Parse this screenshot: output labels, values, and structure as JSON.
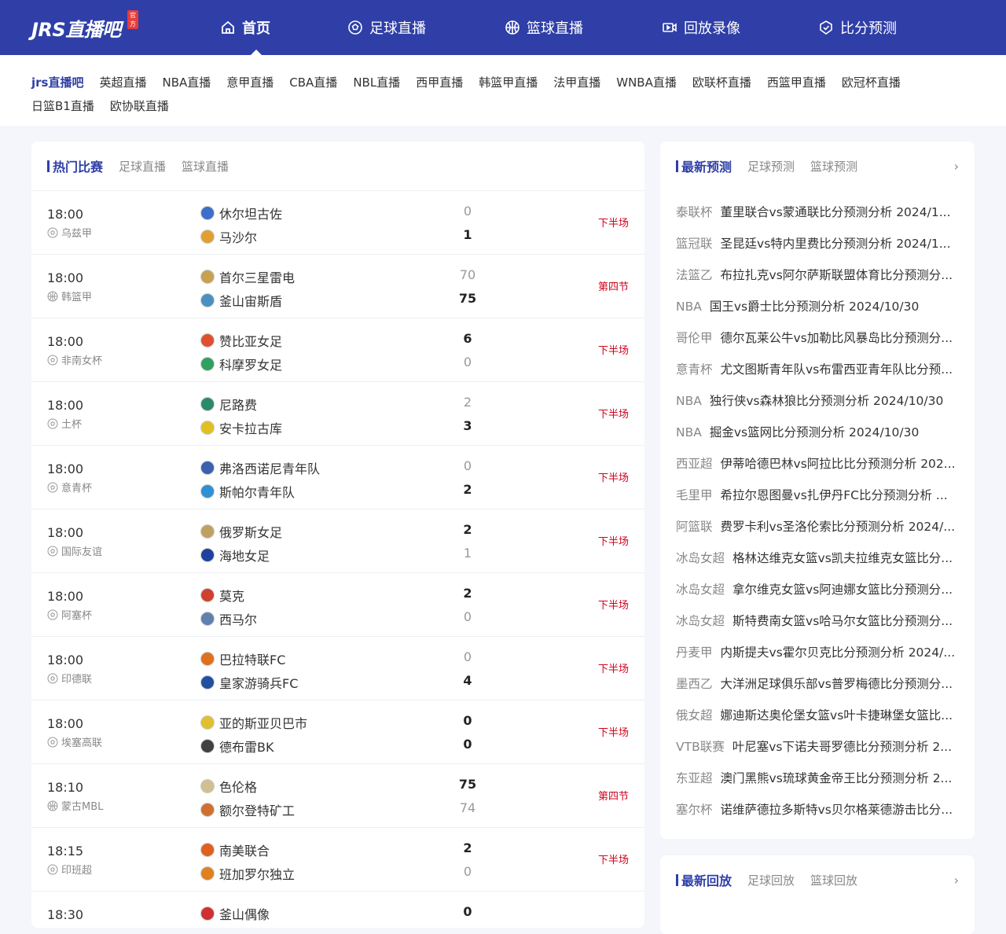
{
  "header": {
    "logo": "JRS直播吧",
    "badge": "官方",
    "nav": [
      {
        "label": "首页",
        "icon": "home-icon"
      },
      {
        "label": "足球直播",
        "icon": "football-icon"
      },
      {
        "label": "篮球直播",
        "icon": "basketball-icon"
      },
      {
        "label": "回放录像",
        "icon": "video-icon"
      },
      {
        "label": "比分预测",
        "icon": "prediction-icon"
      }
    ]
  },
  "subnav": {
    "row1": [
      "jrs直播吧",
      "英超直播",
      "NBA直播",
      "意甲直播",
      "CBA直播",
      "NBL直播",
      "西甲直播",
      "韩篮甲直播",
      "法甲直播",
      "WNBA直播",
      "欧联杯直播",
      "西篮甲直播",
      "欧冠杯直播"
    ],
    "row2": [
      "日篮B1直播",
      "欧协联直播"
    ]
  },
  "hot": {
    "title": "热门比赛",
    "tabs": [
      "足球直播",
      "篮球直播"
    ],
    "matches": [
      {
        "time": "18:00",
        "league": "乌兹甲",
        "sport": "football",
        "home": "休尔坦古佐",
        "away": "马沙尔",
        "hs": "0",
        "as": "1",
        "status": "下半场",
        "hc": "#3b6fc9",
        "ac": "#e0a030"
      },
      {
        "time": "18:00",
        "league": "韩篮甲",
        "sport": "basketball",
        "home": "首尔三星雷电",
        "away": "釜山宙斯盾",
        "hs": "70",
        "as": "75",
        "status": "第四节",
        "hc": "#c8a050",
        "ac": "#4a90c0"
      },
      {
        "time": "18:00",
        "league": "非南女杯",
        "sport": "football",
        "home": "赞比亚女足",
        "away": "科摩罗女足",
        "hs": "6",
        "as": "0",
        "status": "下半场",
        "hc": "#e05030",
        "ac": "#30a060"
      },
      {
        "time": "18:00",
        "league": "土杯",
        "sport": "football",
        "home": "尼路费",
        "away": "安卡拉古库",
        "hs": "2",
        "as": "3",
        "status": "下半场",
        "hc": "#2a8a6a",
        "ac": "#e0c020"
      },
      {
        "time": "18:00",
        "league": "意青杯",
        "sport": "football",
        "home": "弗洛西诺尼青年队",
        "away": "斯帕尔青年队",
        "hs": "0",
        "as": "2",
        "status": "下半场",
        "hc": "#3a60b0",
        "ac": "#3090d0"
      },
      {
        "time": "18:00",
        "league": "国际友谊",
        "sport": "football",
        "home": "俄罗斯女足",
        "away": "海地女足",
        "hs": "2",
        "as": "1",
        "status": "下半场",
        "hc": "#c0a060",
        "ac": "#2040a0"
      },
      {
        "time": "18:00",
        "league": "阿塞杯",
        "sport": "football",
        "home": "莫克",
        "away": "西马尔",
        "hs": "2",
        "as": "0",
        "status": "下半场",
        "hc": "#d04030",
        "ac": "#6080b0"
      },
      {
        "time": "18:00",
        "league": "印德联",
        "sport": "football",
        "home": "巴拉特联FC",
        "away": "皇家游骑兵FC",
        "hs": "0",
        "as": "4",
        "status": "下半场",
        "hc": "#e07020",
        "ac": "#2050a0"
      },
      {
        "time": "18:00",
        "league": "埃塞高联",
        "sport": "football",
        "home": "亚的斯亚贝巴市",
        "away": "德布雷BK",
        "hs": "0",
        "as": "0",
        "status": "下半场",
        "hc": "#e0c030",
        "ac": "#404040"
      },
      {
        "time": "18:10",
        "league": "蒙古MBL",
        "sport": "basketball",
        "home": "色伦格",
        "away": "额尔登特矿工",
        "hs": "75",
        "as": "74",
        "status": "第四节",
        "hc": "#d0c090",
        "ac": "#d07030"
      },
      {
        "time": "18:15",
        "league": "印班超",
        "sport": "football",
        "home": "南美联合",
        "away": "班加罗尔独立",
        "hs": "2",
        "as": "0",
        "status": "下半场",
        "hc": "#e06020",
        "ac": "#e08020"
      },
      {
        "time": "18:30",
        "league": "",
        "sport": "football",
        "home": "釜山偶像",
        "away": "",
        "hs": "0",
        "as": "",
        "status": "",
        "hc": "#d03030",
        "ac": "#ffffff"
      }
    ]
  },
  "predictions": {
    "title": "最新预测",
    "tabs": [
      "足球预测",
      "篮球预测"
    ],
    "more": "›",
    "items": [
      {
        "lg": "泰联杯",
        "text": "董里联合vs蒙通联比分预测分析 2024/1..."
      },
      {
        "lg": "篮冠联",
        "text": "圣昆廷vs特内里费比分预测分析 2024/1..."
      },
      {
        "lg": "法篮乙",
        "text": "布拉扎克vs阿尔萨斯联盟体育比分预测分..."
      },
      {
        "lg": "NBA",
        "text": "国王vs爵士比分预测分析 2024/10/30"
      },
      {
        "lg": "哥伦甲",
        "text": "德尔瓦莱公牛vs加勒比风暴岛比分预测分..."
      },
      {
        "lg": "意青杯",
        "text": "尤文图斯青年队vs布雷西亚青年队比分预..."
      },
      {
        "lg": "NBA",
        "text": "独行侠vs森林狼比分预测分析 2024/10/30"
      },
      {
        "lg": "NBA",
        "text": "掘金vs篮网比分预测分析 2024/10/30"
      },
      {
        "lg": "西亚超",
        "text": "伊蒂哈德巴林vs阿拉比比分预测分析 202..."
      },
      {
        "lg": "毛里甲",
        "text": "希拉尔恩图曼vs扎伊丹FC比分预测分析 ..."
      },
      {
        "lg": "阿篮联",
        "text": "费罗卡利vs圣洛伦索比分预测分析 2024/..."
      },
      {
        "lg": "冰岛女超",
        "text": "格林达维克女篮vs凯夫拉维克女篮比分..."
      },
      {
        "lg": "冰岛女超",
        "text": "拿尔维克女篮vs阿迪娜女篮比分预测分..."
      },
      {
        "lg": "冰岛女超",
        "text": "斯特费南女篮vs哈马尔女篮比分预测分..."
      },
      {
        "lg": "丹麦甲",
        "text": "内斯提夫vs霍尔贝克比分预测分析 2024/..."
      },
      {
        "lg": "墨西乙",
        "text": "大洋洲足球俱乐部vs普罗梅德比分预测分..."
      },
      {
        "lg": "俄女超",
        "text": "娜迪斯达奥伦堡女篮vs叶卡捷琳堡女篮比..."
      },
      {
        "lg": "VTB联赛",
        "text": "叶尼塞vs下诺夫哥罗德比分预测分析 2..."
      },
      {
        "lg": "东亚超",
        "text": "澳门黑熊vs琉球黄金帝王比分预测分析 2..."
      },
      {
        "lg": "塞尔杯",
        "text": "诺维萨德拉多斯特vs贝尔格莱德游击比分..."
      }
    ]
  },
  "replays": {
    "title": "最新回放",
    "tabs": [
      "足球回放",
      "篮球回放"
    ],
    "more": "›"
  }
}
